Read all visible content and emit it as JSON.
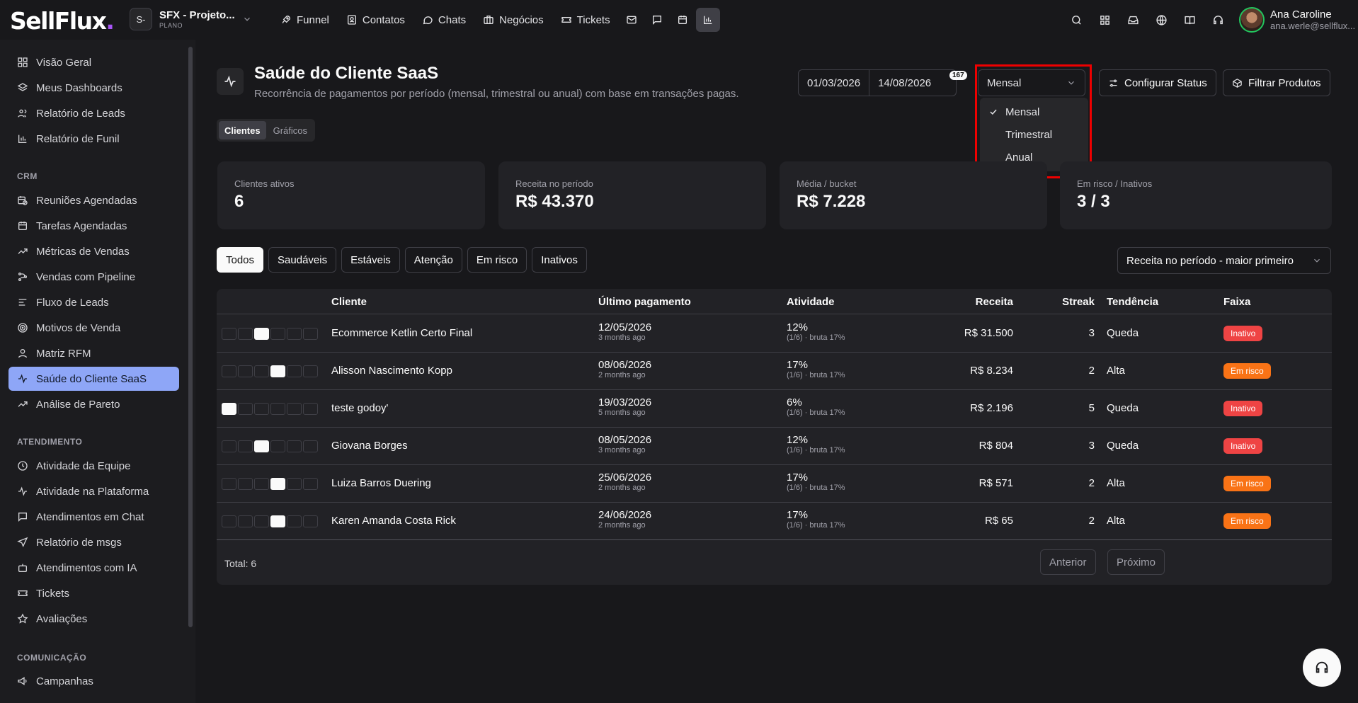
{
  "brand": {
    "logo_text": "SellFlux",
    "logo_dot": "."
  },
  "project": {
    "avatar": "S-",
    "name": "SFX - Projeto...",
    "plan": "PLANO"
  },
  "nav": {
    "items": [
      {
        "label": "Funnel",
        "icon": "rocket-icon"
      },
      {
        "label": "Contatos",
        "icon": "contact-icon"
      },
      {
        "label": "Chats",
        "icon": "chat-icon"
      },
      {
        "label": "Negócios",
        "icon": "briefcase-icon"
      },
      {
        "label": "Tickets",
        "icon": "ticket-icon"
      }
    ],
    "icons": [
      "mail-icon",
      "message-icon",
      "calendar-icon",
      "bar-chart-icon"
    ]
  },
  "user": {
    "name": "Ana Caroline",
    "email": "ana.werle@sellflux..."
  },
  "sidebar": {
    "items_top": [
      "Visão Geral",
      "Meus Dashboards",
      "Relatório de Leads",
      "Relatório de Funil"
    ],
    "section_crm": "CRM",
    "items_crm": [
      "Reuniões Agendadas",
      "Tarefas Agendadas",
      "Métricas de Vendas",
      "Vendas com Pipeline",
      "Fluxo de Leads",
      "Motivos de Venda",
      "Matriz RFM",
      "Saúde do Cliente SaaS",
      "Análise de Pareto"
    ],
    "section_atendimento": "ATENDIMENTO",
    "items_atendimento": [
      "Atividade da Equipe",
      "Atividade na Plataforma",
      "Atendimentos em Chat",
      "Relatório de msgs",
      "Atendimentos com IA",
      "Tickets",
      "Avaliações"
    ],
    "section_comunicacao": "COMUNICAÇÃO",
    "items_comunicacao": [
      "Campanhas"
    ]
  },
  "page": {
    "title": "Saúde do Cliente SaaS",
    "subtitle": "Recorrência de pagamentos por período (mensal, trimestral ou anual) com base em transações pagas.",
    "date_start": "01/03/2026",
    "date_end": "14/08/2026",
    "date_badge": "167",
    "period_selected": "Mensal",
    "period_options": [
      "Mensal",
      "Trimestral",
      "Anual"
    ],
    "configure_status": "Configurar Status",
    "filter_products": "Filtrar Produtos",
    "view_tabs": [
      "Clientes",
      "Gráficos"
    ]
  },
  "stats": [
    {
      "label": "Clientes ativos",
      "value": "6"
    },
    {
      "label": "Receita no período",
      "value": "R$ 43.370"
    },
    {
      "label": "Média / bucket",
      "value": "R$ 7.228"
    },
    {
      "label": "Em risco / Inativos",
      "value": "3 / 3"
    }
  ],
  "filters": [
    "Todos",
    "Saudáveis",
    "Estáveis",
    "Atenção",
    "Em risco",
    "Inativos"
  ],
  "sort": {
    "selected": "Receita no período - maior primeiro"
  },
  "table": {
    "headers": [
      "Cliente",
      "Último pagamento",
      "Atividade",
      "Receita",
      "Streak",
      "Tendência",
      "Faixa"
    ],
    "rows": [
      {
        "cliente": "Ecommerce Ketlin Certo Final",
        "date": "12/05/2026",
        "ago": "3 months ago",
        "activity": "12%",
        "activity_sub": "(1/6) · bruta 17%",
        "receita": "R$ 31.500",
        "streak": "3",
        "tendencia": "Queda",
        "faixa": "Inativo",
        "active_square": 2
      },
      {
        "cliente": "Alisson Nascimento Kopp",
        "date": "08/06/2026",
        "ago": "2 months ago",
        "activity": "17%",
        "activity_sub": "(1/6) · bruta 17%",
        "receita": "R$ 8.234",
        "streak": "2",
        "tendencia": "Alta",
        "faixa": "Em risco",
        "active_square": 3
      },
      {
        "cliente": "teste godoy'",
        "date": "19/03/2026",
        "ago": "5 months ago",
        "activity": "6%",
        "activity_sub": "(1/6) · bruta 17%",
        "receita": "R$ 2.196",
        "streak": "5",
        "tendencia": "Queda",
        "faixa": "Inativo",
        "active_square": 0
      },
      {
        "cliente": "Giovana Borges",
        "date": "08/05/2026",
        "ago": "3 months ago",
        "activity": "12%",
        "activity_sub": "(1/6) · bruta 17%",
        "receita": "R$ 804",
        "streak": "3",
        "tendencia": "Queda",
        "faixa": "Inativo",
        "active_square": 2
      },
      {
        "cliente": "Luiza Barros Duering",
        "date": "25/06/2026",
        "ago": "2 months ago",
        "activity": "17%",
        "activity_sub": "(1/6) · bruta 17%",
        "receita": "R$ 571",
        "streak": "2",
        "tendencia": "Alta",
        "faixa": "Em risco",
        "active_square": 3
      },
      {
        "cliente": "Karen Amanda Costa Rick",
        "date": "24/06/2026",
        "ago": "2 months ago",
        "activity": "17%",
        "activity_sub": "(1/6) · bruta 17%",
        "receita": "R$ 65",
        "streak": "2",
        "tendencia": "Alta",
        "faixa": "Em risco",
        "active_square": 3
      }
    ],
    "total": "Total: 6",
    "prev": "Anterior",
    "next": "Próximo"
  },
  "colors": {
    "accent": "#8ea6f7",
    "inactive": "#ef4444",
    "risk": "#f97316",
    "highlight": "#e00000"
  }
}
